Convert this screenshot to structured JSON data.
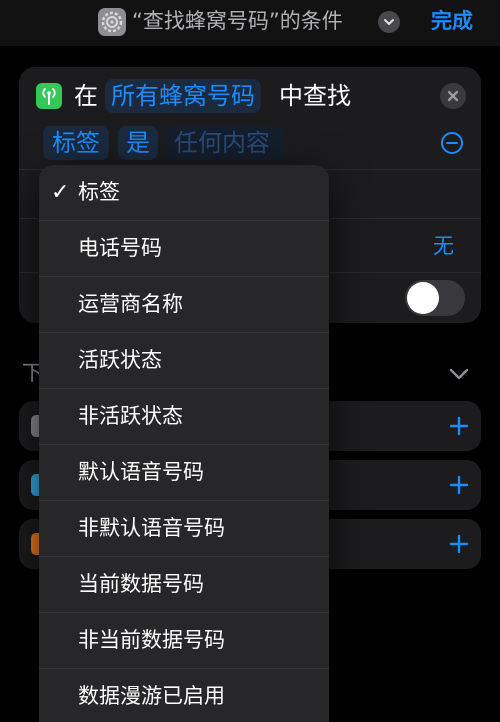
{
  "header": {
    "title": "“查找蜂窝号码”的条件",
    "done_label": "完成"
  },
  "filter": {
    "prefix": "在",
    "scope": "所有蜂窝号码",
    "suffix": "中查找",
    "field": "标签",
    "operator": "是",
    "value_placeholder": "任何内容",
    "row3_value": "无"
  },
  "section": {
    "label_peek": "下"
  },
  "menu": {
    "selected_index": 0,
    "check_glyph": "✓",
    "items": [
      {
        "label": "标签"
      },
      {
        "label": "电话号码"
      },
      {
        "label": "运营商名称"
      },
      {
        "label": "活跃状态"
      },
      {
        "label": "非活跃状态"
      },
      {
        "label": "默认语音号码"
      },
      {
        "label": "非默认语音号码"
      },
      {
        "label": "当前数据号码"
      },
      {
        "label": "非当前数据号码"
      },
      {
        "label": "数据漫游已启用"
      }
    ]
  },
  "colors": {
    "accent": "#1a8cff",
    "cellular_icon": "#34c759",
    "row_icon_1": "#8e8e93",
    "row_icon_2": "#32ade6",
    "row_icon_3": "#f07a1a"
  },
  "icons": {
    "header_app": "settings-gear-icon",
    "header_chevron": "chevron-down-icon",
    "cell_icon": "antenna-icon",
    "close": "close-icon",
    "minus": "minus-circle-icon",
    "plus": "plus-icon",
    "section_chevron": "chevron-down-icon"
  }
}
